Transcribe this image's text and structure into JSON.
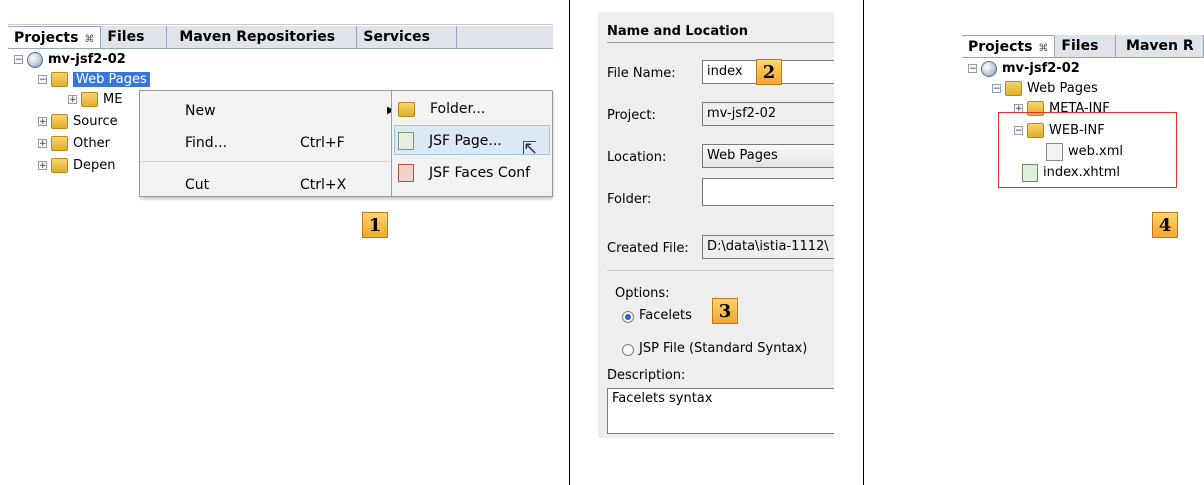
{
  "panel1": {
    "tabs": [
      {
        "label": "Projects",
        "close": "⌘"
      },
      {
        "label": "Files"
      },
      {
        "label": "Maven Repositories"
      },
      {
        "label": "Services"
      }
    ],
    "tree": {
      "project": "mv-jsf2-02",
      "web_pages": "Web Pages",
      "child_meta": "ME",
      "source": "Source",
      "other": "Other",
      "dependencies": "Depen"
    },
    "menu": [
      {
        "label": "New",
        "shortcut": ""
      },
      {
        "label": "Find...",
        "shortcut": "Ctrl+F"
      },
      {
        "label": "Cut",
        "shortcut": "Ctrl+X"
      }
    ],
    "submenu": [
      {
        "label": "Folder..."
      },
      {
        "label": "JSF Page..."
      },
      {
        "label": "JSF Faces Conf"
      }
    ],
    "badge": "1"
  },
  "panel2": {
    "section_title": "Name and Location",
    "file_name_label": "File Name:",
    "file_name_value": "index",
    "project_label": "Project:",
    "project_value": "mv-jsf2-02",
    "location_label": "Location:",
    "location_value": "Web Pages",
    "folder_label": "Folder:",
    "folder_value": "",
    "created_file_label": "Created File:",
    "created_file_value": "D:\\data\\istia-1112\\",
    "options_label": "Options:",
    "option_facelets": "Facelets",
    "option_jsp": "JSP File (Standard Syntax)",
    "description_label": "Description:",
    "description_value": "Facelets syntax",
    "badge_name": "2",
    "badge_options": "3"
  },
  "panel4": {
    "tabs": [
      {
        "label": "Projects",
        "close": "⌘"
      },
      {
        "label": "Files"
      },
      {
        "label": "Maven R"
      }
    ],
    "tree": {
      "project": "mv-jsf2-02",
      "web_pages": "Web Pages",
      "meta_inf": "META-INF",
      "web_inf": "WEB-INF",
      "web_xml": "web.xml",
      "index": "index.xhtml"
    },
    "badge": "4"
  }
}
